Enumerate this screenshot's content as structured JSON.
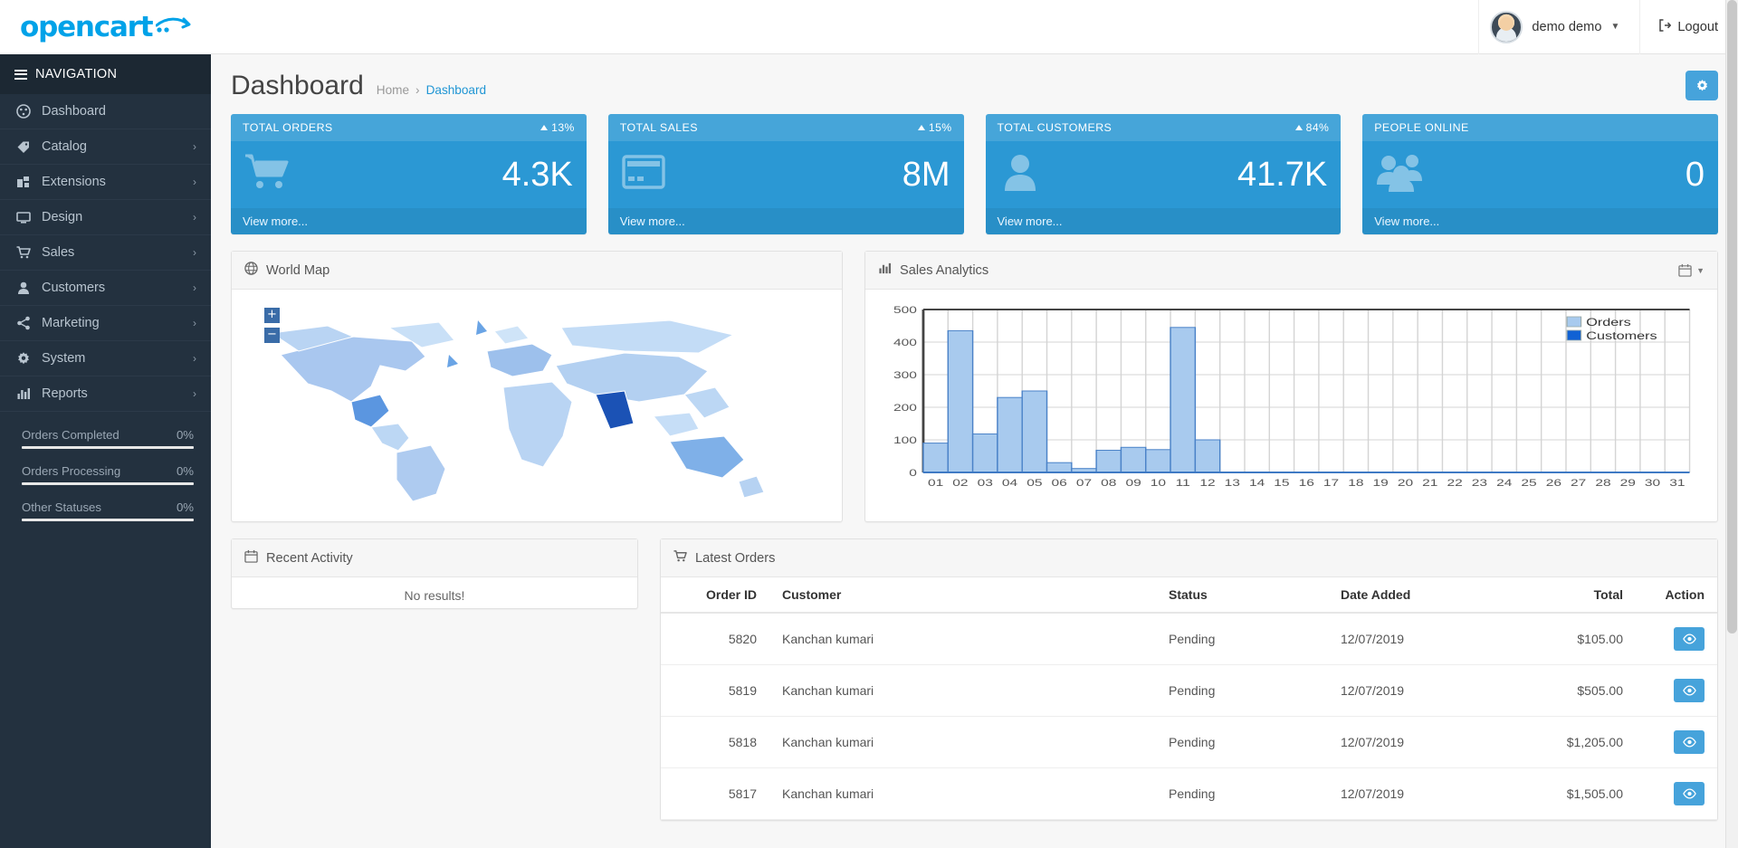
{
  "brand": {
    "name": "opencart",
    "logo_color": "#00a2e8"
  },
  "topbar": {
    "user_name": "demo demo",
    "logout_label": "Logout"
  },
  "page": {
    "title": "Dashboard",
    "breadcrumb_home": "Home",
    "breadcrumb_sep": "›",
    "breadcrumb_current": "Dashboard"
  },
  "sidebar": {
    "nav_label": "NAVIGATION",
    "items": [
      {
        "label": "Dashboard",
        "icon": "dashboard-icon",
        "has_caret": false
      },
      {
        "label": "Catalog",
        "icon": "tag-icon",
        "has_caret": true
      },
      {
        "label": "Extensions",
        "icon": "puzzle-icon",
        "has_caret": true
      },
      {
        "label": "Design",
        "icon": "monitor-icon",
        "has_caret": true
      },
      {
        "label": "Sales",
        "icon": "cart-icon",
        "has_caret": true
      },
      {
        "label": "Customers",
        "icon": "user-icon",
        "has_caret": true
      },
      {
        "label": "Marketing",
        "icon": "share-icon",
        "has_caret": true
      },
      {
        "label": "System",
        "icon": "gear-icon",
        "has_caret": true
      },
      {
        "label": "Reports",
        "icon": "bar-chart-icon",
        "has_caret": true
      }
    ],
    "progress": [
      {
        "label": "Orders Completed",
        "value": "0%",
        "percent": 0
      },
      {
        "label": "Orders Processing",
        "value": "0%",
        "percent": 0
      },
      {
        "label": "Other Statuses",
        "value": "0%",
        "percent": 0
      }
    ]
  },
  "cards": [
    {
      "title": "TOTAL ORDERS",
      "percent": "13%",
      "value": "4.3K",
      "footer": "View more...",
      "icon": "shopping-cart-icon"
    },
    {
      "title": "TOTAL SALES",
      "percent": "15%",
      "value": "8M",
      "footer": "View more...",
      "icon": "credit-card-icon"
    },
    {
      "title": "TOTAL CUSTOMERS",
      "percent": "84%",
      "value": "41.7K",
      "footer": "View more...",
      "icon": "person-icon"
    },
    {
      "title": "PEOPLE ONLINE",
      "percent": "",
      "value": "0",
      "footer": "View more...",
      "icon": "people-icon"
    }
  ],
  "map_panel": {
    "title": "World Map",
    "zoom_in": "+",
    "zoom_out": "−"
  },
  "analytics_panel": {
    "title": "Sales Analytics"
  },
  "activity_panel": {
    "title": "Recent Activity",
    "empty_text": "No results!"
  },
  "orders_panel": {
    "title": "Latest Orders",
    "columns": [
      "Order ID",
      "Customer",
      "Status",
      "Date Added",
      "Total",
      "Action"
    ],
    "rows": [
      {
        "order_id": "5820",
        "customer": "Kanchan kumari",
        "status": "Pending",
        "date_added": "12/07/2019",
        "total": "$105.00"
      },
      {
        "order_id": "5819",
        "customer": "Kanchan kumari",
        "status": "Pending",
        "date_added": "12/07/2019",
        "total": "$505.00"
      },
      {
        "order_id": "5818",
        "customer": "Kanchan kumari",
        "status": "Pending",
        "date_added": "12/07/2019",
        "total": "$1,205.00"
      },
      {
        "order_id": "5817",
        "customer": "Kanchan kumari",
        "status": "Pending",
        "date_added": "12/07/2019",
        "total": "$1,505.00"
      }
    ]
  },
  "chart_data": {
    "type": "bar",
    "title": "Sales Analytics",
    "xlabel": "",
    "ylabel": "",
    "ylim": [
      0,
      500
    ],
    "yticks": [
      0,
      100,
      200,
      300,
      400,
      500
    ],
    "grid": true,
    "legend_position": "top-right",
    "categories": [
      "01",
      "02",
      "03",
      "04",
      "05",
      "06",
      "07",
      "08",
      "09",
      "10",
      "11",
      "12",
      "13",
      "14",
      "15",
      "16",
      "17",
      "18",
      "19",
      "20",
      "21",
      "22",
      "23",
      "24",
      "25",
      "26",
      "27",
      "28",
      "29",
      "30",
      "31"
    ],
    "series": [
      {
        "name": "Orders",
        "color": "#a8caee",
        "values": [
          90,
          435,
          118,
          230,
          250,
          30,
          12,
          68,
          77,
          70,
          445,
          100,
          0,
          0,
          0,
          0,
          0,
          0,
          0,
          0,
          0,
          0,
          0,
          0,
          0,
          0,
          0,
          0,
          0,
          0,
          0
        ]
      },
      {
        "name": "Customers",
        "color": "#1061d4",
        "values": [
          0,
          0,
          0,
          0,
          0,
          0,
          0,
          0,
          0,
          0,
          0,
          0,
          0,
          0,
          0,
          0,
          0,
          0,
          0,
          0,
          0,
          0,
          0,
          0,
          0,
          0,
          0,
          0,
          0,
          0,
          0
        ]
      }
    ]
  },
  "colors": {
    "accent": "#2b98d4",
    "sidebar": "#23313f",
    "button": "#46a3db"
  }
}
